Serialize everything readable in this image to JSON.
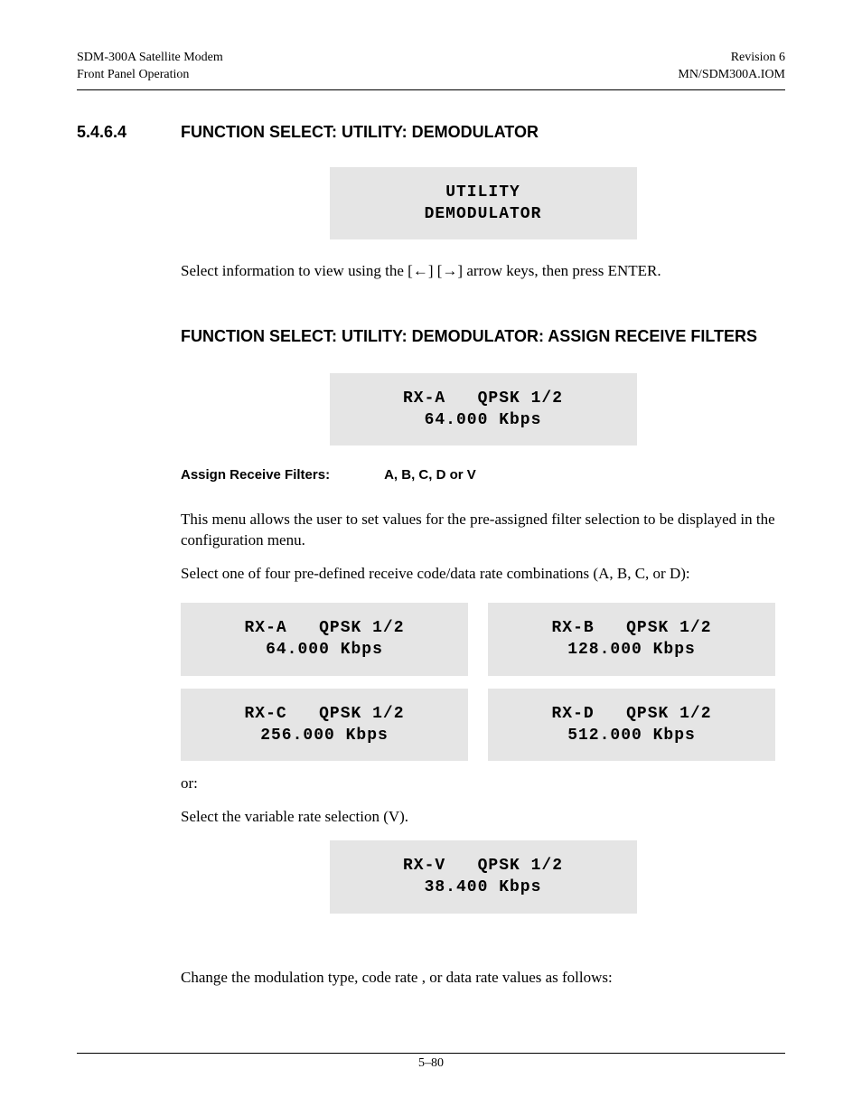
{
  "header": {
    "left_line1": "SDM-300A Satellite Modem",
    "left_line2": "Front Panel Operation",
    "right_line1": "Revision 6",
    "right_line2": "MN/SDM300A.IOM"
  },
  "section": {
    "number": "5.4.6.4",
    "title": "FUNCTION SELECT: UTILITY: DEMODULATOR"
  },
  "lcd_utility": {
    "line1": "UTILITY",
    "line2": "DEMODULATOR"
  },
  "para1_a": "Select information to view using the [",
  "para1_b": "] [",
  "para1_c": "] arrow keys, then press ENTER.",
  "arrow_left": "←",
  "arrow_right": "→",
  "subhead": "FUNCTION SELECT: UTILITY: DEMODULATOR: ASSIGN RECEIVE FILTERS",
  "lcd_rxa_main": {
    "line1": "RX-A   QPSK 1/2",
    "line2": "64.000 Kbps"
  },
  "assign_label": "Assign Receive Filters:",
  "assign_values": "A, B, C, D or  V",
  "para2": "This menu allows the user to set values for the pre-assigned filter selection to be displayed in the configuration menu.",
  "para3": "Select one of four  pre-defined receive code/data rate combinations (A, B, C, or D):",
  "grid": {
    "a": {
      "line1": "RX-A   QPSK 1/2",
      "line2": "64.000 Kbps"
    },
    "b": {
      "line1": "RX-B   QPSK 1/2",
      "line2": "128.000 Kbps"
    },
    "c": {
      "line1": "RX-C   QPSK 1/2",
      "line2": "256.000 Kbps"
    },
    "d": {
      "line1": "RX-D   QPSK 1/2",
      "line2": "512.000 Kbps"
    }
  },
  "para_or": "or:",
  "para4": "Select the variable rate selection (V).",
  "lcd_rxv": {
    "line1": "RX-V   QPSK 1/2",
    "line2": "38.400 Kbps"
  },
  "para5": "Change the modulation type, code rate , or data rate values as follows:",
  "page_number": "5–80"
}
